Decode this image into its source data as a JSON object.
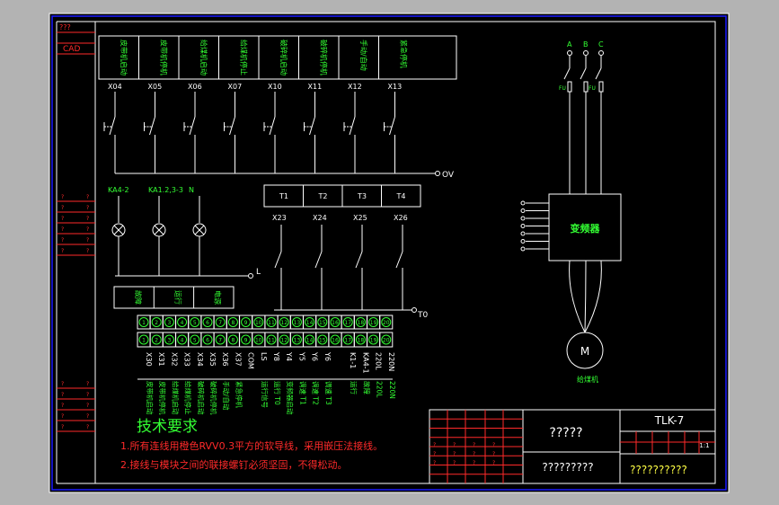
{
  "side_labels": {
    "top": "???",
    "cad": "CAD"
  },
  "switch_blocks": [
    {
      "desc": "皮带机启动",
      "tag": "X04"
    },
    {
      "desc": "皮带机停机",
      "tag": "X05"
    },
    {
      "desc": "给煤机启动",
      "tag": "X06"
    },
    {
      "desc": "给煤机停止",
      "tag": "X07"
    },
    {
      "desc": "破碎机启动",
      "tag": "X10"
    },
    {
      "desc": "破碎机停机",
      "tag": "X11"
    },
    {
      "desc": "手动/自动",
      "tag": "X12"
    },
    {
      "desc": "紧急停机",
      "tag": "X13"
    }
  ],
  "ov_label": "OV",
  "lamp_tags": [
    "KA4-2",
    "KA1.2,3-3",
    "N"
  ],
  "l_label": "L",
  "lamp_desc": [
    "故障",
    "运行",
    "电源"
  ],
  "t_blocks": [
    "T1",
    "T2",
    "T3",
    "T4"
  ],
  "out_tags": [
    "X23",
    "X24",
    "X25",
    "X26"
  ],
  "t0_label": "T0",
  "terminals": [
    {
      "n": "1",
      "code": "X30",
      "desc": "皮带机启动"
    },
    {
      "n": "2",
      "code": "X31",
      "desc": "皮带机停机"
    },
    {
      "n": "3",
      "code": "X32",
      "desc": "给煤机启动"
    },
    {
      "n": "4",
      "code": "X33",
      "desc": "给煤机停止"
    },
    {
      "n": "5",
      "code": "X34",
      "desc": "破碎机启动"
    },
    {
      "n": "6",
      "code": "X35",
      "desc": "破碎机停机"
    },
    {
      "n": "7",
      "code": "X36",
      "desc": "手动/自动"
    },
    {
      "n": "8",
      "code": "X37",
      "desc": "紧急停机"
    },
    {
      "n": "9",
      "code": "COM",
      "desc": ""
    },
    {
      "n": "10",
      "code": "LS",
      "desc": "运行信号"
    },
    {
      "n": "11",
      "code": "Y8",
      "desc": "运行 T0"
    },
    {
      "n": "12",
      "code": "Y4",
      "desc": "变频器启动"
    },
    {
      "n": "13",
      "code": "Y5",
      "desc": "调速 T1"
    },
    {
      "n": "14",
      "code": "Y6",
      "desc": "调速 T2"
    },
    {
      "n": "15",
      "code": "Y6",
      "desc": "调速 T3"
    },
    {
      "n": "16",
      "code": "",
      "desc": ""
    },
    {
      "n": "17",
      "code": "K1-1",
      "desc": "运行"
    },
    {
      "n": "18",
      "code": "KA4-1",
      "desc": "故障"
    },
    {
      "n": "19",
      "code": "220L",
      "desc": "220L"
    },
    {
      "n": "20",
      "code": "220N",
      "desc": "220N"
    }
  ],
  "phase_labels": [
    "A",
    "B",
    "C"
  ],
  "fuse_label": "FU",
  "vfd_label": "变频器",
  "motor_label": "M",
  "motor_caption": "给煤机",
  "tech_title": "技术要求",
  "tech_notes": [
    "1.所有连线用橙色RVV0.3平方的软导线，采用嵌压法接线。",
    "2.接线与模块之间的联接螺钉必须坚固，不得松动。"
  ],
  "title_block": {
    "drawing_name": "?????",
    "drawing_no": "TLK-7",
    "company": "?????????",
    "company2": "??????????",
    "scale": "1:1"
  }
}
